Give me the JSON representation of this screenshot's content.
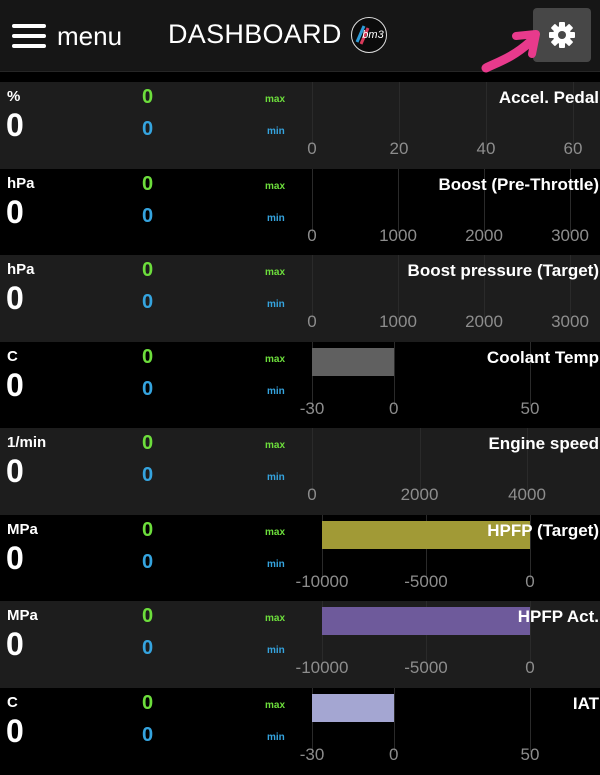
{
  "header": {
    "menu_label": "menu",
    "title": "DASHBOARD",
    "logo_text": "bm3",
    "settings_icon": "gear-icon",
    "menu_icon": "hamburger-icon",
    "annotation_color": "#e83a8c"
  },
  "labels": {
    "max": "max",
    "min": "min"
  },
  "gauges": [
    {
      "unit": "%",
      "value": "0",
      "max": "0",
      "min": "0",
      "name": "Accel. Pedal",
      "ticks": [
        "0",
        "20",
        "40",
        "60"
      ]
    },
    {
      "unit": "hPa",
      "value": "0",
      "max": "0",
      "min": "0",
      "name": "Boost (Pre-Throttle)",
      "ticks": [
        "0",
        "1000",
        "2000",
        "3000"
      ]
    },
    {
      "unit": "hPa",
      "value": "0",
      "max": "0",
      "min": "0",
      "name": "Boost pressure (Target)",
      "ticks": [
        "0",
        "1000",
        "2000",
        "3000"
      ]
    },
    {
      "unit": "C",
      "value": "0",
      "max": "0",
      "min": "0",
      "name": "Coolant Temp",
      "ticks": [
        "-30",
        "0",
        "50"
      ],
      "bar_color": "#606060"
    },
    {
      "unit": "1/min",
      "value": "0",
      "max": "0",
      "min": "0",
      "name": "Engine speed",
      "ticks": [
        "0",
        "2000",
        "4000"
      ]
    },
    {
      "unit": "MPa",
      "value": "0",
      "max": "0",
      "min": "0",
      "name": "HPFP (Target)",
      "ticks": [
        "-10000",
        "-5000",
        "0"
      ],
      "bar_color": "#a19a36"
    },
    {
      "unit": "MPa",
      "value": "0",
      "max": "0",
      "min": "0",
      "name": "HPFP Act.",
      "ticks": [
        "-10000",
        "-5000",
        "0"
      ],
      "bar_color": "#6e5a9b"
    },
    {
      "unit": "C",
      "value": "0",
      "max": "0",
      "min": "0",
      "name": "IAT",
      "ticks": [
        "-30",
        "0",
        "50"
      ],
      "bar_color": "#a4a6d2"
    }
  ]
}
